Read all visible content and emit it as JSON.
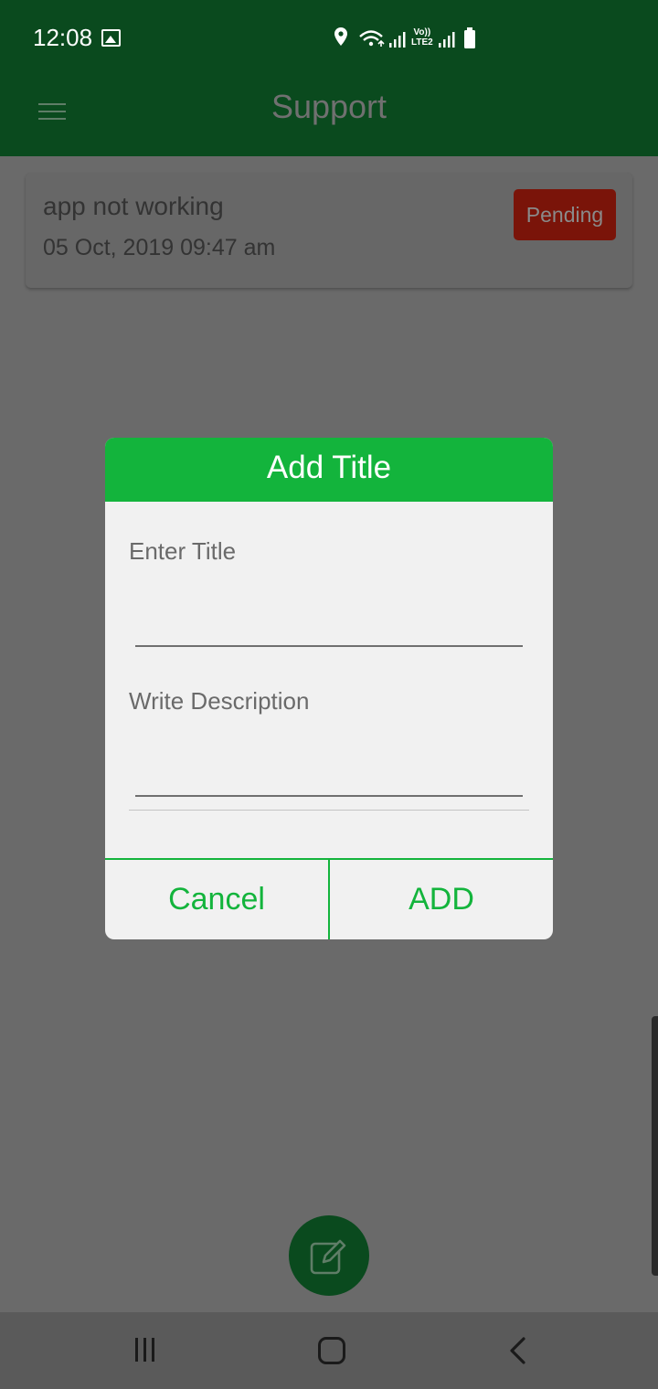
{
  "status_bar": {
    "time": "12:08",
    "network_label_top": "Vo))",
    "network_label_bottom": "LTE2"
  },
  "app_bar": {
    "title": "Support",
    "menu_icon": "hamburger-menu-icon"
  },
  "tickets": [
    {
      "title": "app not working",
      "date": "05 Oct, 2019 09:47 am",
      "status": "Pending"
    }
  ],
  "dialog": {
    "title": "Add Title",
    "title_field_label": "Enter Title",
    "title_field_value": "",
    "description_field_label": "Write Description",
    "description_field_value": "",
    "cancel_label": "Cancel",
    "add_label": "ADD"
  },
  "fab": {
    "icon": "edit-icon"
  },
  "colors": {
    "brand_green": "#13b43c",
    "app_bar": "#0b5c20",
    "pending_badge": "#b3140a",
    "dialog_background": "#f1f1f1"
  }
}
